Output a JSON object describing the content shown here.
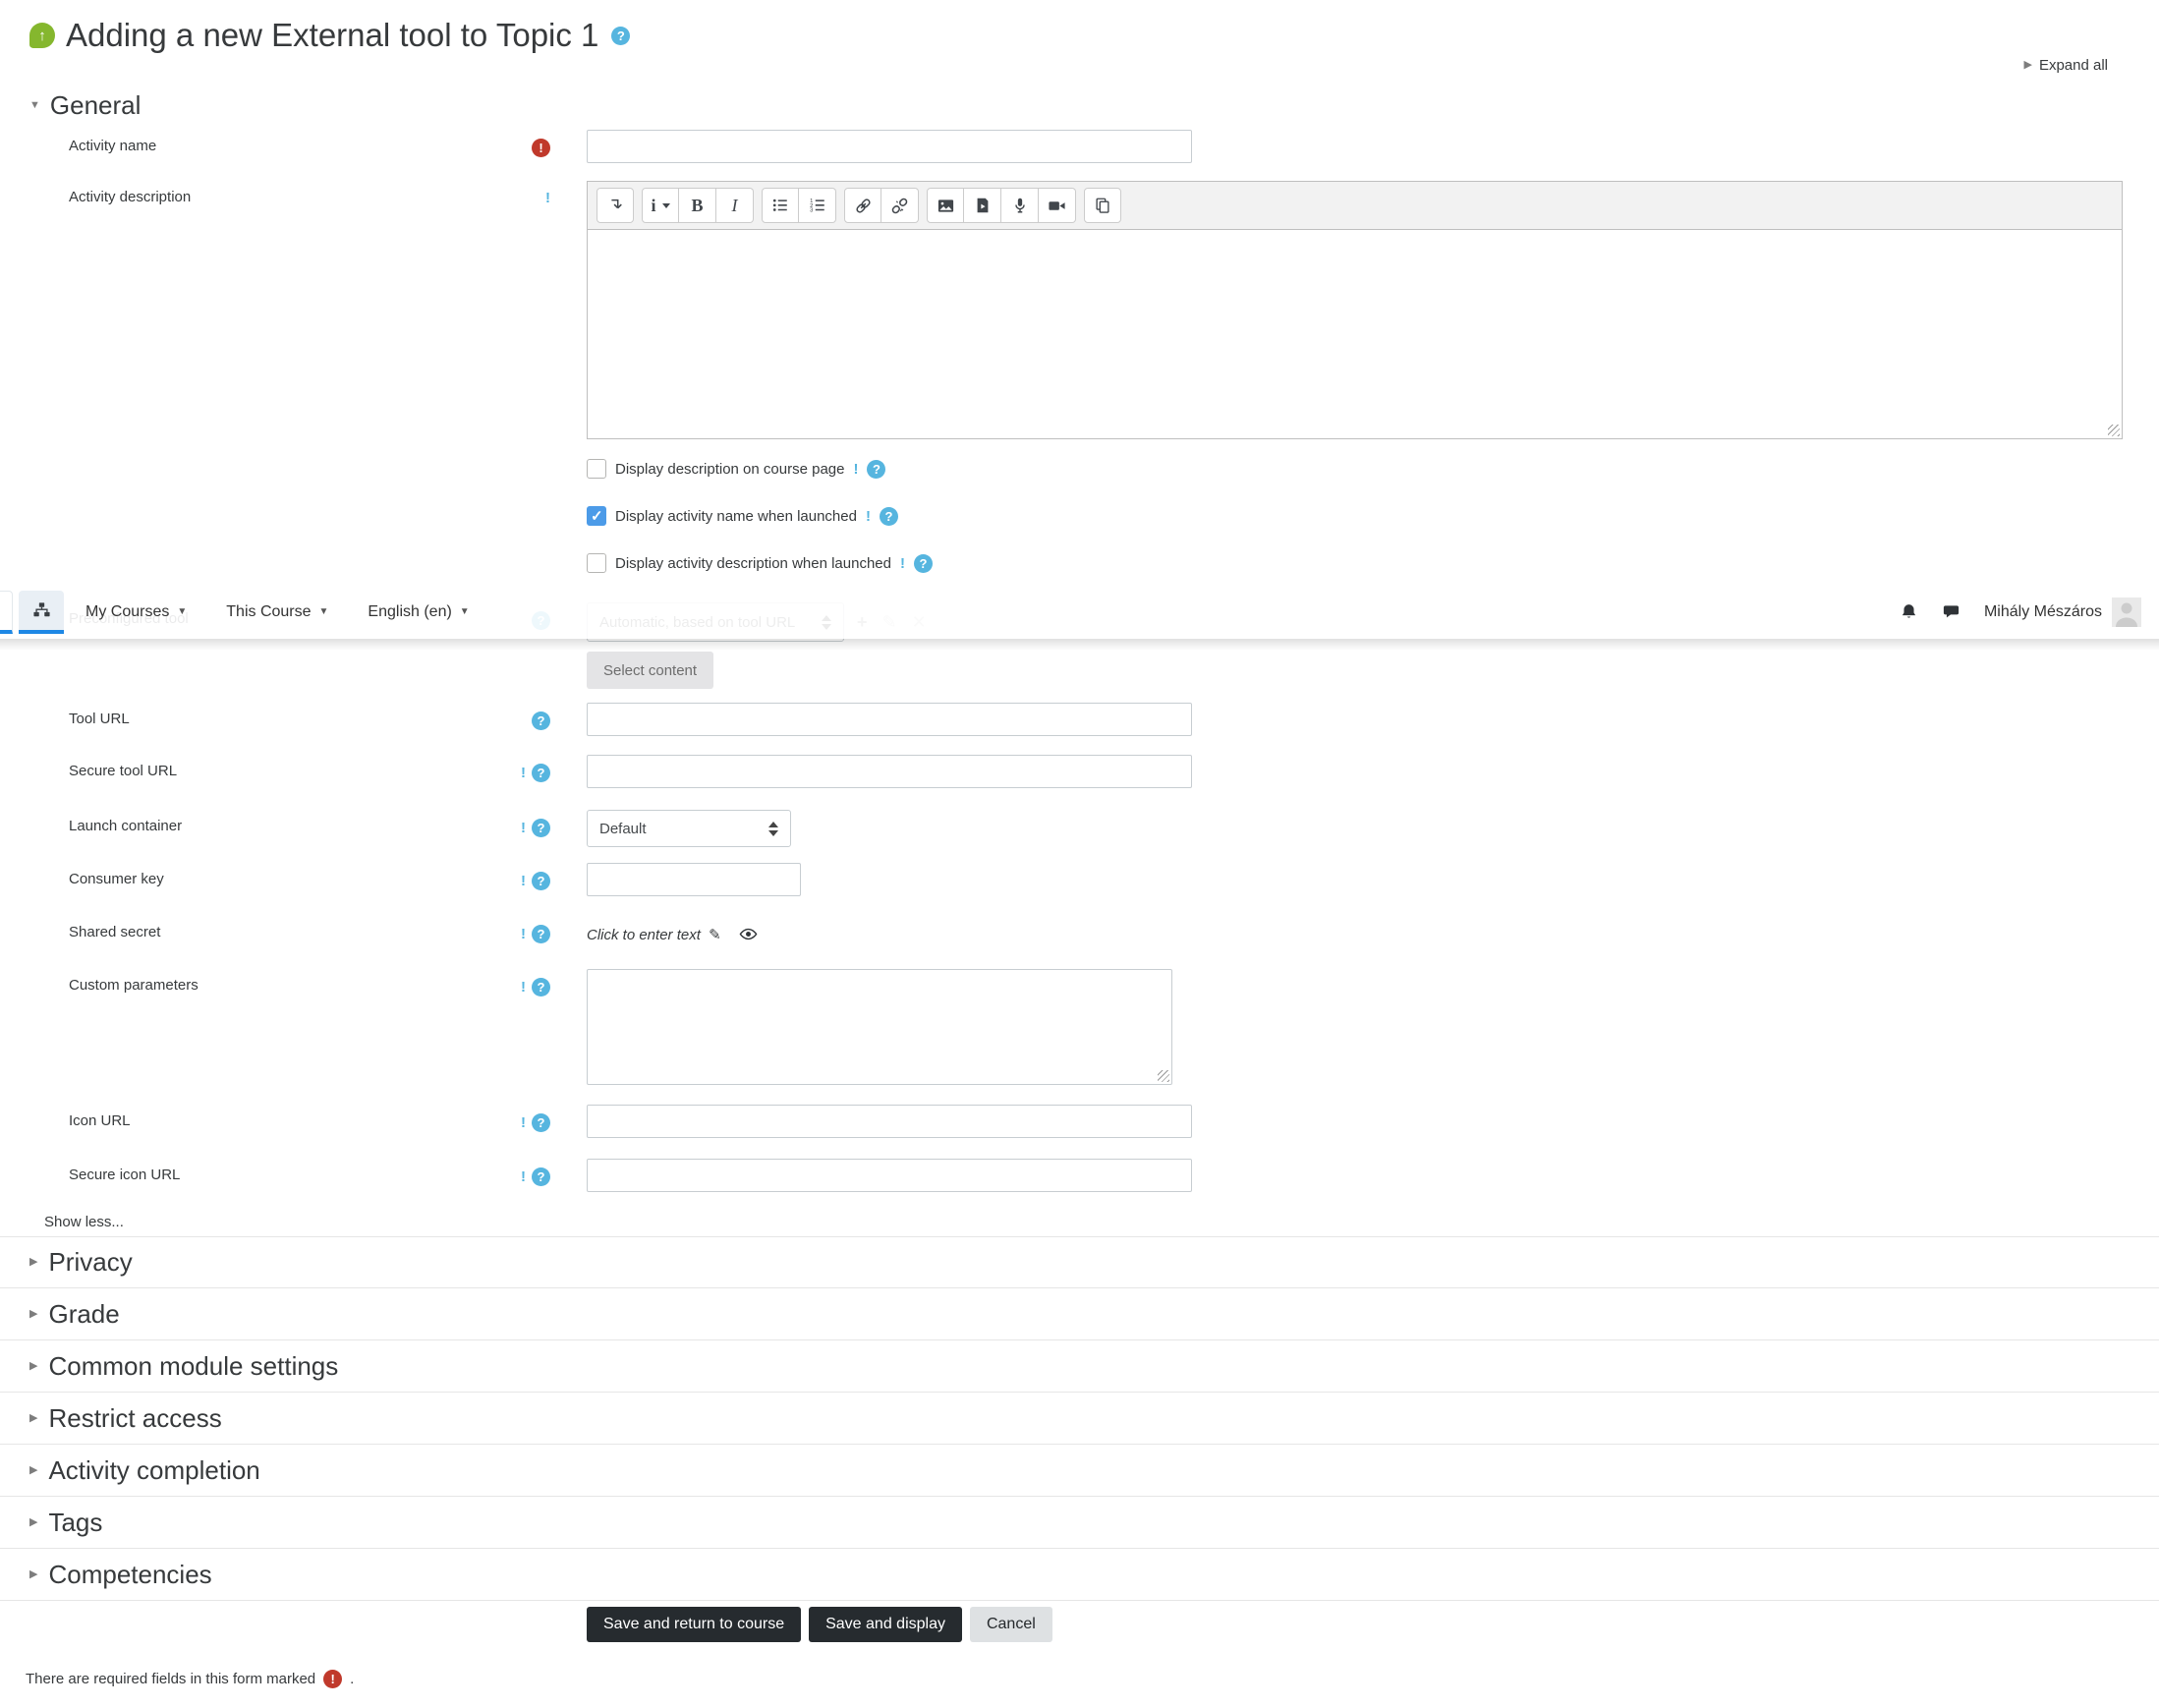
{
  "page": {
    "title": "Adding a new External tool to Topic 1",
    "expand_all_label": "Expand all",
    "show_less_label": "Show less...",
    "required_note": "There are required fields in this form marked",
    "required_note_period": "."
  },
  "navbar": {
    "menus": [
      {
        "label": "My Courses"
      },
      {
        "label": "This Course"
      },
      {
        "label": "English (en)"
      }
    ],
    "user_name": "Mihály Mészáros"
  },
  "general_section": {
    "title": "General"
  },
  "collapsed_sections": [
    {
      "title": "Privacy"
    },
    {
      "title": "Grade"
    },
    {
      "title": "Common module settings"
    },
    {
      "title": "Restrict access"
    },
    {
      "title": "Activity completion"
    },
    {
      "title": "Tags"
    },
    {
      "title": "Competencies"
    }
  ],
  "fields": {
    "activity_name": {
      "label": "Activity name",
      "value": ""
    },
    "activity_description": {
      "label": "Activity description",
      "value": ""
    },
    "preconfigured_tool": {
      "label": "Preconfigured tool",
      "selected": "Automatic, based on tool URL"
    },
    "select_content_button": "Select content",
    "tool_url": {
      "label": "Tool URL",
      "value": ""
    },
    "secure_tool_url": {
      "label": "Secure tool URL",
      "value": ""
    },
    "launch_container": {
      "label": "Launch container",
      "selected": "Default"
    },
    "consumer_key": {
      "label": "Consumer key",
      "value": ""
    },
    "shared_secret": {
      "label": "Shared secret",
      "placeholder": "Click to enter text"
    },
    "custom_parameters": {
      "label": "Custom parameters",
      "value": ""
    },
    "icon_url": {
      "label": "Icon URL",
      "value": ""
    },
    "secure_icon_url": {
      "label": "Secure icon URL",
      "value": ""
    }
  },
  "checkboxes": [
    {
      "label": "Display description on course page",
      "checked": false
    },
    {
      "label": "Display activity name when launched",
      "checked": true
    },
    {
      "label": "Display activity description when launched",
      "checked": false
    }
  ],
  "editor": {
    "styles_button_glyph": "i",
    "bold_glyph": "B",
    "italic_glyph": "I"
  },
  "buttons": {
    "save_return": "Save and return to course",
    "save_display": "Save and display",
    "cancel": "Cancel"
  },
  "icons": {
    "help": "?",
    "required": "!",
    "advanced": "!",
    "collapsed_caret": "▶",
    "expanded_caret": "▼",
    "menu_caret": "▾",
    "add": "+",
    "edit": "✎",
    "delete": "✕",
    "pencil": "✎",
    "tool_arrow": "↑"
  },
  "colors": {
    "accent_blue": "#1e88e5",
    "help_blue": "#56b5df",
    "required_red": "#c0392b",
    "dark_button": "#262b2f",
    "tool_green": "#85b72e"
  }
}
